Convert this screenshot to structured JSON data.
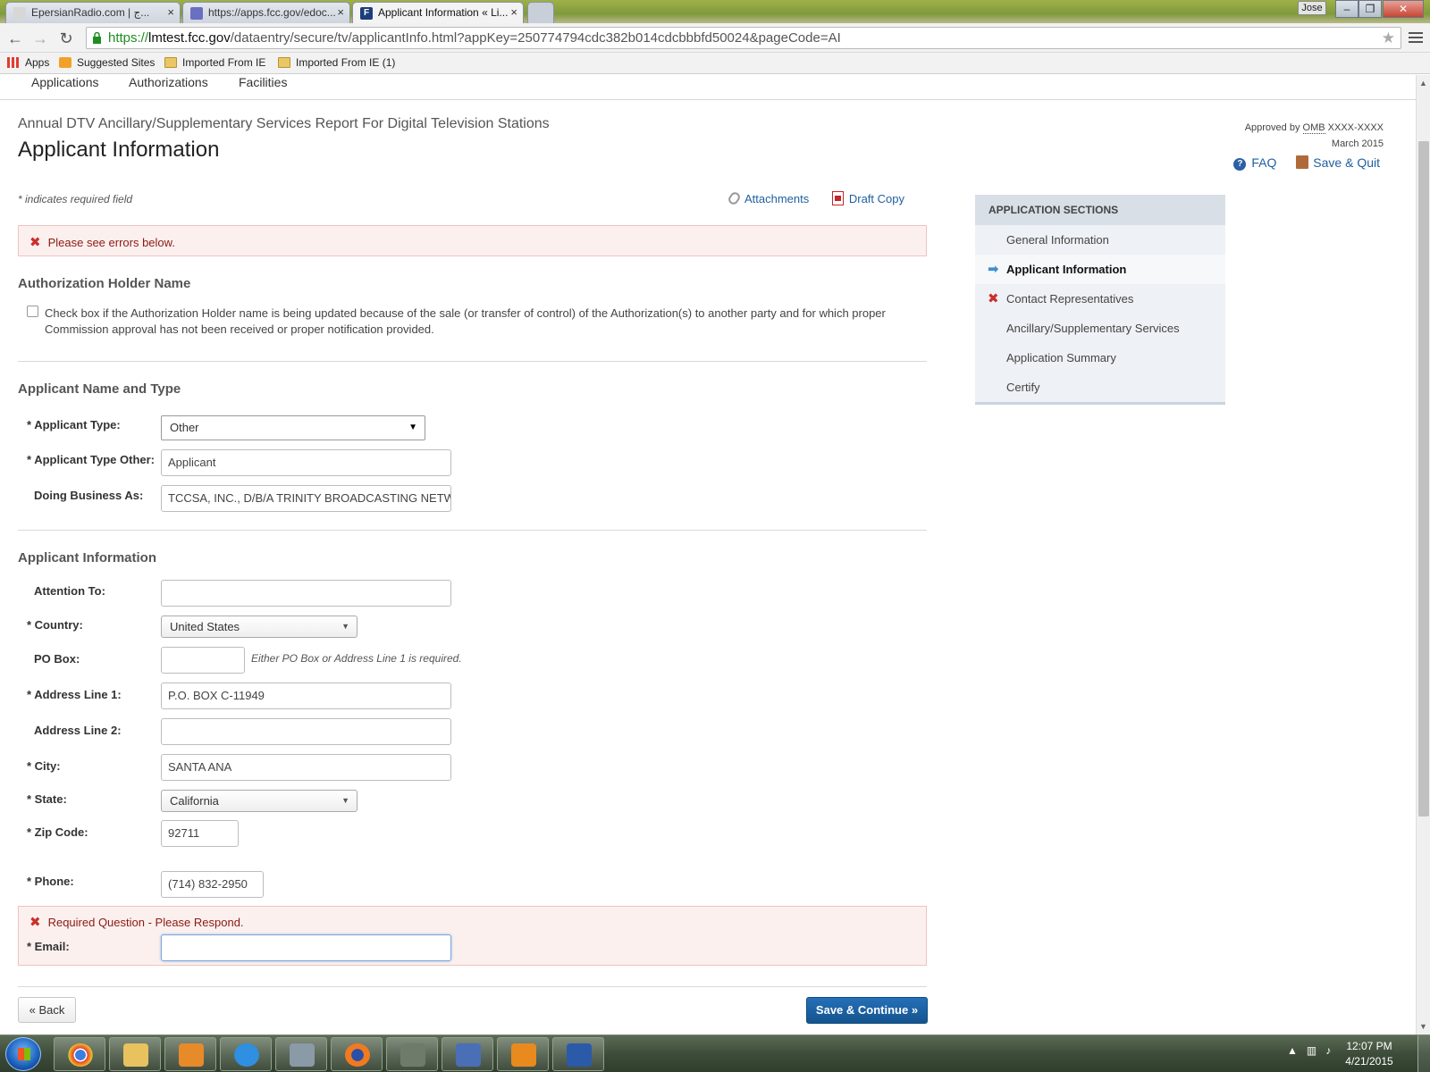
{
  "browser": {
    "tabs": [
      {
        "title": "EpersianRadio.com | ج..."
      },
      {
        "title": "https://apps.fcc.gov/edoc..."
      },
      {
        "title": "Applicant Information « Li..."
      }
    ],
    "user_label": "Jose",
    "url_scheme": "https://",
    "url_host": "lmtest.fcc.gov",
    "url_path": "/dataentry/secure/tv/applicantInfo.html?appKey=250774794cdc382b014cdcbbbfd50024&pageCode=AI",
    "bookmarks": [
      "Apps",
      "Suggested Sites",
      "Imported From IE",
      "Imported From IE (1)"
    ]
  },
  "nav": {
    "items": [
      "Applications",
      "Authorizations",
      "Facilities"
    ]
  },
  "header": {
    "form_title": "Annual DTV Ancillary/Supplementary Services Report For Digital Television Stations",
    "page_title": "Applicant Information",
    "approved_prefix": "Approved by",
    "omb": "OMB",
    "omb_number": "XXXX-XXXX",
    "date": "March 2015",
    "faq": "FAQ",
    "save_quit": "Save & Quit"
  },
  "form": {
    "required_note": "* indicates required field",
    "attachments": "Attachments",
    "draft_copy": "Draft Copy",
    "error_banner": "Please see errors below.",
    "auth_holder": {
      "heading": "Authorization Holder Name",
      "checkbox_text": "Check box if the Authorization Holder name is being updated because of the sale (or transfer of control) of the Authorization(s) to another party and for which proper Commission approval has not been received or proper notification provided."
    },
    "name_type": {
      "heading": "Applicant Name and Type",
      "applicant_type_label": "* Applicant Type:",
      "applicant_type_value": "Other",
      "applicant_type_other_label": "* Applicant Type Other:",
      "applicant_type_other_value": "Applicant",
      "dba_label": "Doing Business As:",
      "dba_value": "TCCSA, INC., D/B/A TRINITY BROADCASTING NETWORK"
    },
    "info": {
      "heading": "Applicant Information",
      "attention_label": "Attention To:",
      "attention_value": "",
      "country_label": "* Country:",
      "country_value": "United States",
      "po_box_label": "PO Box:",
      "po_box_value": "",
      "po_box_hint": "Either PO Box or Address Line 1 is required.",
      "address1_label": "* Address Line 1:",
      "address1_value": "P.O. BOX C-11949",
      "address2_label": "Address Line 2:",
      "address2_value": "",
      "city_label": "* City:",
      "city_value": "SANTA ANA",
      "state_label": "* State:",
      "state_value": "California",
      "zip_label": "* Zip Code:",
      "zip_value": "92711",
      "phone_label": "* Phone:",
      "phone_value": "(714) 832-2950",
      "email_error": "Required Question - Please Respond.",
      "email_label": "* Email:",
      "email_value": ""
    },
    "back_button": "« Back",
    "save_continue_button": "Save & Continue »"
  },
  "sidebar": {
    "heading": "APPLICATION SECTIONS",
    "items": [
      {
        "label": "General Information",
        "state": "normal"
      },
      {
        "label": "Applicant Information",
        "state": "current"
      },
      {
        "label": "Contact Representatives",
        "state": "error"
      },
      {
        "label": "Ancillary/Supplementary Services",
        "state": "normal"
      },
      {
        "label": "Application Summary",
        "state": "normal"
      },
      {
        "label": "Certify",
        "state": "normal"
      }
    ]
  },
  "taskbar": {
    "time": "12:07 PM",
    "date": "4/21/2015"
  },
  "colors": {
    "link": "#1f5f9f",
    "error": "#c9302c",
    "primary_button": "#1a5c9c"
  }
}
